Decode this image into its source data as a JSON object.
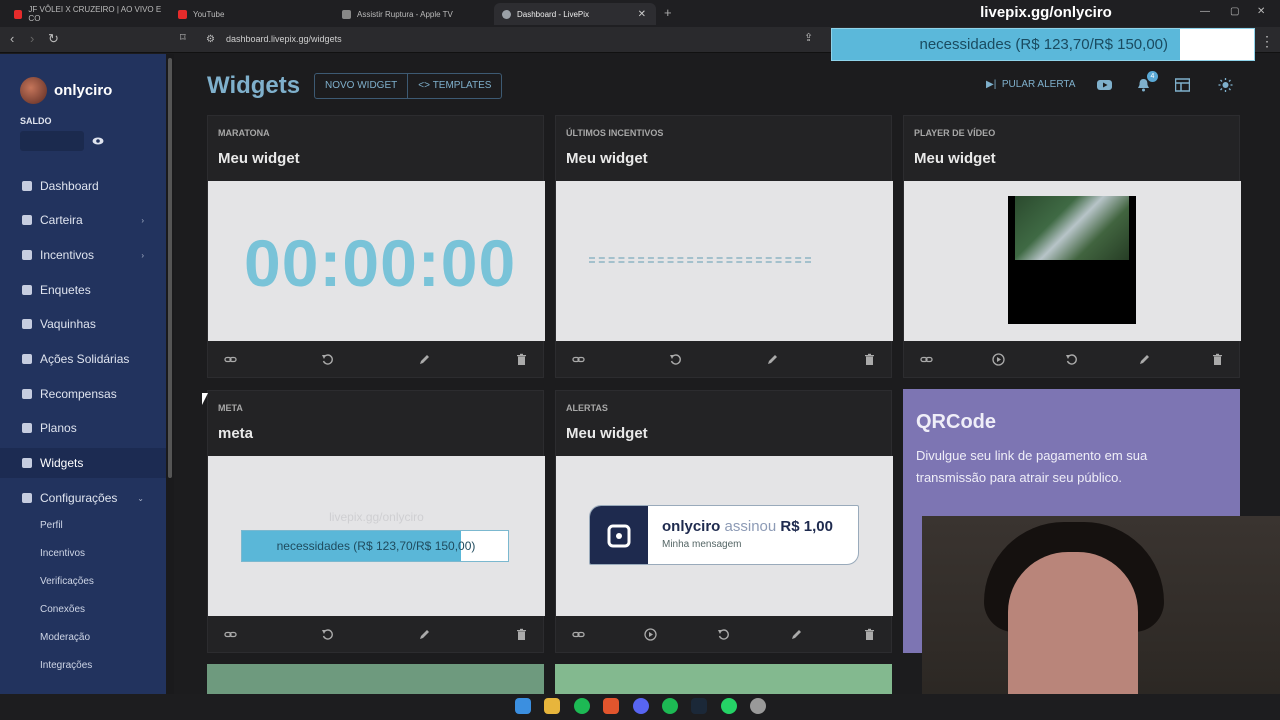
{
  "browser": {
    "tabs": [
      {
        "label": "JF VÔLEI X CRUZEIRO | AO VIVO E CO",
        "favicon_color": "#e62b2b"
      },
      {
        "label": "YouTube",
        "favicon_color": "#e62b2b"
      },
      {
        "label": "Assistir Ruptura - Apple TV",
        "favicon_color": "#888888"
      },
      {
        "label": "Dashboard - LivePix",
        "favicon_color": "#9aa0a6"
      }
    ],
    "url": "dashboard.livepix.gg/widgets"
  },
  "overlay": {
    "title": "livepix.gg/onlyciro",
    "goal_text": "necessidades (R$ 123,70/R$ 150,00)",
    "goal_progress": 0.825
  },
  "sidebar": {
    "username": "onlyciro",
    "saldo_label": "SALDO",
    "items": [
      {
        "label": "Dashboard",
        "name": "dashboard",
        "chevron": false
      },
      {
        "label": "Carteira",
        "name": "carteira",
        "chevron": true
      },
      {
        "label": "Incentivos",
        "name": "incentivos",
        "chevron": true
      },
      {
        "label": "Enquetes",
        "name": "enquetes",
        "chevron": false
      },
      {
        "label": "Vaquinhas",
        "name": "vaquinhas",
        "chevron": false
      },
      {
        "label": "Ações Solidárias",
        "name": "acoes-solidarias",
        "chevron": false
      },
      {
        "label": "Recompensas",
        "name": "recompensas",
        "chevron": false
      },
      {
        "label": "Planos",
        "name": "planos",
        "chevron": false
      },
      {
        "label": "Widgets",
        "name": "widgets",
        "chevron": false,
        "active": true
      },
      {
        "label": "Configurações",
        "name": "configuracoes",
        "chevron": true
      }
    ],
    "sub_items": [
      "Perfil",
      "Incentivos",
      "Verificações",
      "Conexões",
      "Moderação",
      "Integrações"
    ]
  },
  "header": {
    "title": "Widgets",
    "new_widget": "NOVO WIDGET",
    "templates": "TEMPLATES",
    "skip_alert": "PULAR ALERTA",
    "notification_count": "4"
  },
  "widgets": [
    {
      "type": "MARATONA",
      "name": "Meu widget",
      "timer": "00:00:00"
    },
    {
      "type": "ÚLTIMOS INCENTIVOS",
      "name": "Meu widget"
    },
    {
      "type": "PLAYER DE VÍDEO",
      "name": "Meu widget"
    },
    {
      "type": "META",
      "name": "meta",
      "ghost": "livepix.gg/onlyciro",
      "bar_text": "necessidades (R$ 123,70/R$ 150,00)",
      "progress": 0.825
    },
    {
      "type": "ALERTAS",
      "name": "Meu widget",
      "alert_user": "onlyciro",
      "alert_action": "assinou",
      "alert_amount": "R$ 1,00",
      "alert_message": "Minha mensagem"
    }
  ],
  "qrcode": {
    "title": "QRCode",
    "description": "Divulgue seu link de pagamento em sua transmissão para atrair seu público."
  },
  "colors": {
    "sidebar": "#22335e",
    "accent": "#7fb0cc",
    "qr_card": "#7d75b3"
  }
}
